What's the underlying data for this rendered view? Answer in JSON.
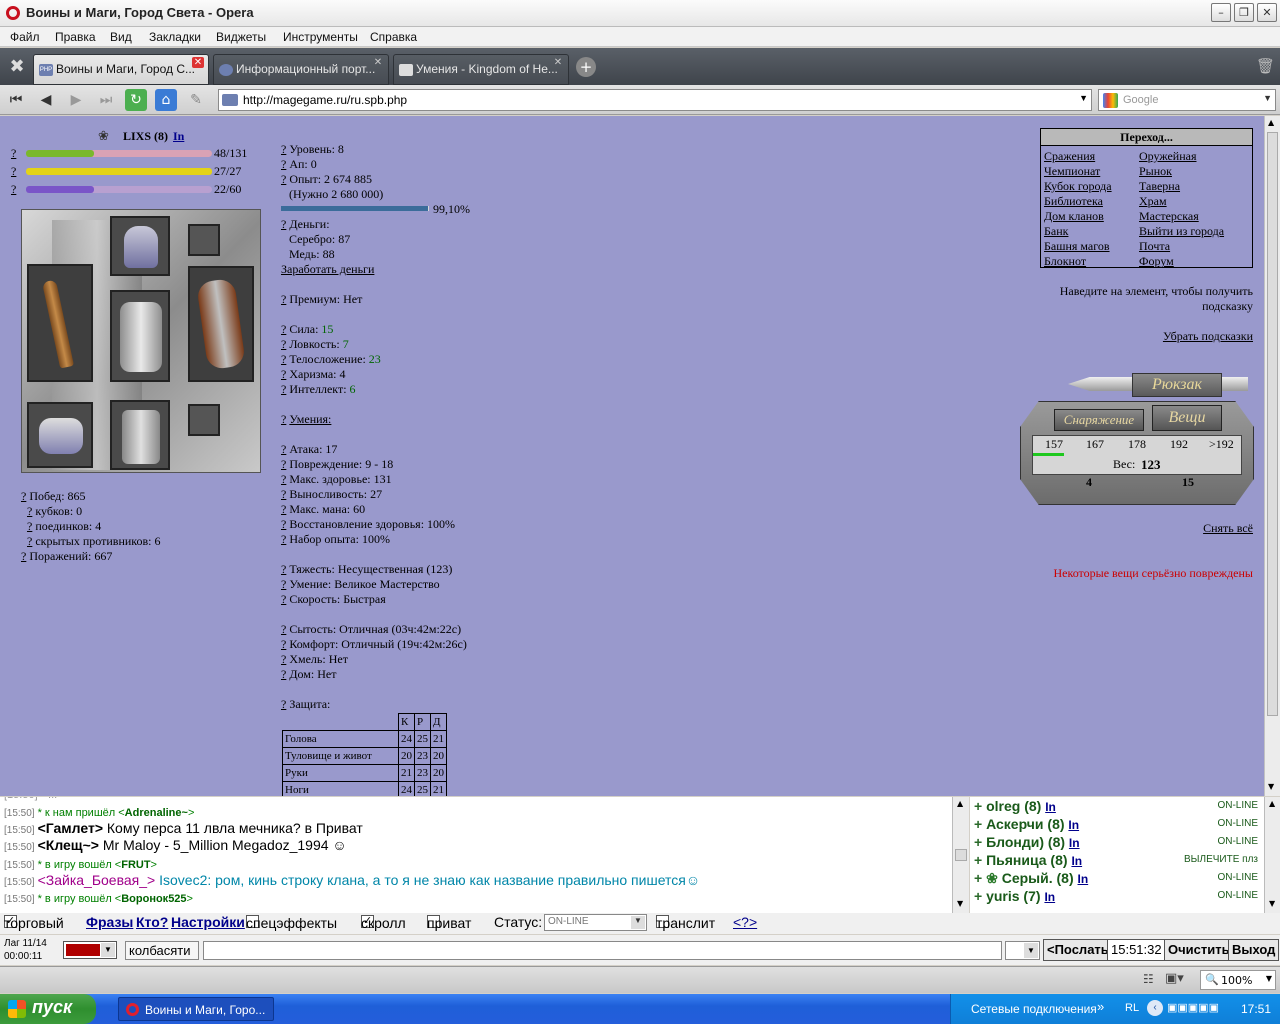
{
  "window": {
    "title": "Воины и Маги, Город Света - Opera"
  },
  "menu": [
    "Файл",
    "Правка",
    "Вид",
    "Закладки",
    "Виджеты",
    "Инструменты",
    "Справка"
  ],
  "tabs": [
    {
      "label": "Воины и Маги, Город С..."
    },
    {
      "label": "Информационный порт..."
    },
    {
      "label": "Умения - Kingdom of He..."
    }
  ],
  "address": {
    "url": "http://magegame.ru/ru.spb.php",
    "search_placeholder": "Google"
  },
  "character": {
    "name": "LIXS (8)",
    "in_link": "In",
    "hp": "48/131",
    "hp_fraction": 0.366,
    "energy": "27/27",
    "energy_fraction": 1.0,
    "mana": "22/60",
    "mana_fraction": 0.367
  },
  "record": {
    "wins": "Побед: 865",
    "cups": "кубков: 0",
    "duels": "поединков: 4",
    "hidden": "скрытых противников: 6",
    "losses": "Поражений: 667"
  },
  "stats": {
    "level": "Уровень: 8",
    "ap": "Ап: 0",
    "exp": "Опыт: 2 674 885",
    "exp_need": "(Нужно 2 680 000)",
    "exp_pct": "99,10%",
    "exp_fraction": 0.991,
    "money": "Деньги:",
    "silver": "Серебро: 87",
    "copper": "Медь: 88",
    "earn": "Заработать деньги",
    "premium": "Премиум: Нет",
    "str_label": "Сила: ",
    "str": "15",
    "agi_label": "Ловкость: ",
    "agi": "7",
    "con_label": "Телосложение: ",
    "con": "23",
    "cha": "Харизма: 4",
    "int_label": "Интеллект: ",
    "int": "6",
    "skills": "Умения:",
    "attack": "Атака: 17",
    "damage": "Повреждение: 9 - 18",
    "max_hp": "Макс. здоровье: 131",
    "stamina": "Выносливость: 27",
    "max_mana": "Макс. мана: 60",
    "regen": "Восстановление здоровья: 100%",
    "exp_gain": "Набор опыта: 100%",
    "weight": "Тяжесть: Несущественная (123)",
    "skill": "Умение: Великое Мастерство",
    "speed": "Скорость: Быстрая",
    "satiety": "Сытость: Отличная (03ч:42м:22с)",
    "comfort": "Комфорт: Отличный (19ч:42м:26с)",
    "hops": "Хмель: Нет",
    "house": "Дом: Нет",
    "protection": "Защита:",
    "q": "?"
  },
  "protection": {
    "headers": [
      "К",
      "Р",
      "Д"
    ],
    "rows": [
      {
        "part": "Голова",
        "v": [
          "24",
          "25",
          "21"
        ]
      },
      {
        "part": "Туловище и живот",
        "v": [
          "20",
          "23",
          "20"
        ]
      },
      {
        "part": "Руки",
        "v": [
          "21",
          "23",
          "20"
        ]
      },
      {
        "part": "Ноги",
        "v": [
          "24",
          "25",
          "21"
        ]
      }
    ]
  },
  "transitions": {
    "title": "Переход...",
    "left": [
      "Сражения",
      "Чемпионат",
      "Кубок города",
      "Библиотека",
      "Дом кланов",
      "Банк",
      "Башня магов",
      "Блокнот"
    ],
    "right": [
      "Оружейная",
      "Рынок",
      "Таверна",
      "Храм",
      "Мастерская",
      "Выйти из города",
      "Почта",
      "Форум"
    ]
  },
  "hint": {
    "text1": "Наведите на элемент, чтобы получить",
    "text2": "подсказку",
    "remove": "Убрать подсказки"
  },
  "backpack": {
    "title": "Рюкзак",
    "equip_tab": "Снаряжение",
    "items_tab": "Вещи",
    "scale": [
      "157",
      "167",
      "178",
      "192",
      ">192"
    ],
    "weight_label": "Вес: ",
    "weight": "123",
    "count_left": "4",
    "count_right": "15",
    "fill_fraction": 0.15
  },
  "remove_all": "Снять всё",
  "damaged": "Некоторые вещи серьёзно повреждены",
  "chat": [
    {
      "time": "[15:50]",
      "text": "* к нам пришёл <",
      "nick": "Adrenaline~",
      "end": ">",
      "type": "sys"
    },
    {
      "time": "[15:50]",
      "speaker": "<Гамлет>",
      "text": " Кому перса 11 лвла мечника? в Приват",
      "type": "msg"
    },
    {
      "time": "[15:50]",
      "speaker": "<Клещ~>",
      "text": " Mr Maloy - 5_Million Megadoz_1994 ☺",
      "type": "msg"
    },
    {
      "time": "[15:50]",
      "text": "* в игру вошёл <",
      "nick": "FRUT",
      "end": ">",
      "type": "sys"
    },
    {
      "time": "[15:50]",
      "speaker": "<Зайка_Боевая_>",
      "text": " Isovec2: ром, кинь строку клана, а то я не знаю как название правильно пишется☺",
      "type": "msg2"
    },
    {
      "time": "[15:50]",
      "text": "* в игру вошёл <",
      "nick": "Воронок525",
      "end": ">",
      "type": "sys"
    }
  ],
  "users": [
    {
      "name": "olreg (8)",
      "in": "In",
      "status": "ON-LINE"
    },
    {
      "name": "Аскерчи (8)",
      "in": "In",
      "status": "ON-LINE"
    },
    {
      "name": "Блонди) (8)",
      "in": "In",
      "status": "ON-LINE"
    },
    {
      "name": "Пьяница (8)",
      "in": "In",
      "status": "ВЫЛЕЧИТЕ плз"
    },
    {
      "name": "Серый. (8)",
      "in": "In",
      "status": "ON-LINE"
    },
    {
      "name": "yuris (7)",
      "in": "In",
      "status": "ON-LINE"
    }
  ],
  "controls": {
    "trade": "торговый",
    "phrases": "Фразы",
    "who": "Кто?",
    "settings": "Настройки",
    "effects": "спецэффекты",
    "scroll": "скролл",
    "private": "приват",
    "status_label": "Статус:",
    "status_value": "ON-LINE",
    "translit": "транслит",
    "translit_help": "<?>",
    "lag": "Лаг 11/14",
    "timer": "00:00:11",
    "input_prefix": "колбасяти",
    "send": "<Послать",
    "clock": "15:51:32",
    "clear": "Очистить",
    "exit": "Выход"
  },
  "statusbar": {
    "zoom": "100%"
  },
  "taskbar": {
    "start": "пуск",
    "task": "Воины и Маги, Горо...",
    "tray_text": "Сетевые подключения",
    "lang": "RL",
    "clock": "17:51"
  },
  "colors": {
    "content_bg": "#9999cc",
    "hp": "#7ab82c",
    "energy": "#d8c820",
    "mana": "#7a55c8",
    "exp_bar": "#3b6c9a"
  }
}
